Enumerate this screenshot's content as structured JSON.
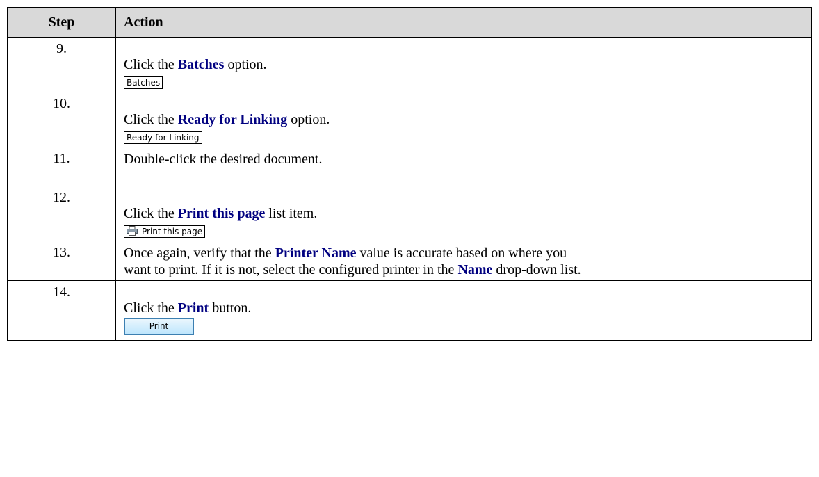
{
  "table": {
    "headers": [
      "Step",
      "Action"
    ],
    "rows": [
      {
        "step": "9.",
        "pre": "Click the ",
        "bold": "Batches",
        "post": " option.",
        "shot": "Batches"
      },
      {
        "step": "10.",
        "pre": "Click the ",
        "bold": "Ready for Linking",
        "post": " option.",
        "shot": "Ready for Linking"
      },
      {
        "step": "11.",
        "text": "Double-click the desired document."
      },
      {
        "step": "12.",
        "pre": "Click the ",
        "bold": "Print this page",
        "post": " list item.",
        "shot": "Print this page",
        "shot_icon": "printer-icon"
      },
      {
        "step": "13.",
        "line1_pre": "Once again, verify that the ",
        "line1_bold": "Printer Name",
        "line1_post": " value is accurate based on where you",
        "line2_pre": "want to print.  If it is not, select the configured printer in the ",
        "line2_bold": "Name",
        "line2_post": " drop-down list."
      },
      {
        "step": "14.",
        "pre": "Click the ",
        "bold": "Print",
        "post": " button.",
        "shot": "Print"
      }
    ]
  },
  "colors": {
    "keyword": "#000080",
    "header_bg": "#d9d9d9",
    "button_border": "#3c7fb1"
  }
}
